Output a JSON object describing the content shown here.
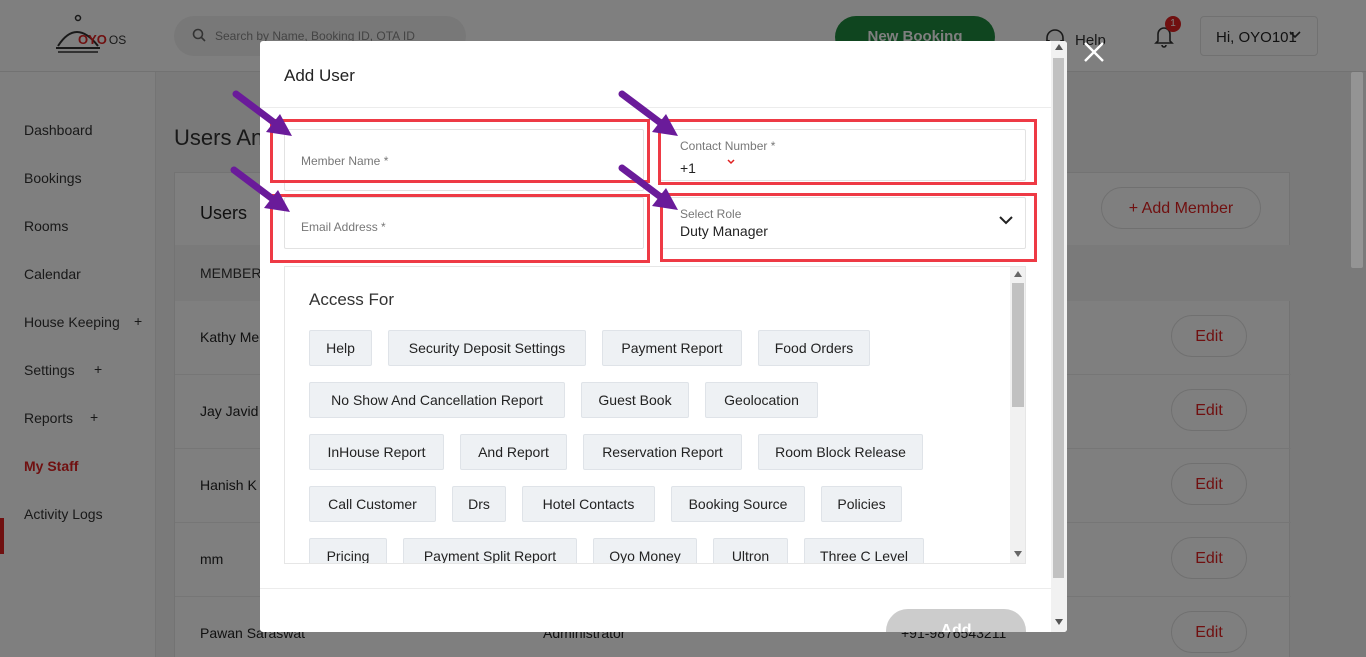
{
  "app": {
    "logo_text": "OYO",
    "logo_suffix": "OS",
    "search_placeholder": "Search by Name, Booking ID, OTA ID",
    "new_booking_label": "New Booking",
    "help_label": "Help",
    "notification_count": "1",
    "user_greeting": "Hi, OYO101"
  },
  "sidebar": {
    "items": [
      {
        "label": "Dashboard"
      },
      {
        "label": "Bookings"
      },
      {
        "label": "Rooms"
      },
      {
        "label": "Calendar"
      },
      {
        "label": "House Keeping",
        "expand": "+"
      },
      {
        "label": "Settings",
        "expand": "+"
      },
      {
        "label": "Reports",
        "expand": "+"
      },
      {
        "label": "My Staff"
      },
      {
        "label": "Activity Logs"
      }
    ]
  },
  "main": {
    "title": "Users And Access",
    "card_title": "Users",
    "add_member_label": "+  Add Member",
    "column_member": "MEMBER",
    "rows": [
      {
        "name": "Kathy Me",
        "role": "",
        "phone": "",
        "edit": "Edit"
      },
      {
        "name": "Jay Javid",
        "role": "",
        "phone": "",
        "edit": "Edit"
      },
      {
        "name": "Hanish K",
        "role": "",
        "phone": "",
        "edit": "Edit"
      },
      {
        "name": "mm",
        "role": "",
        "phone": "",
        "edit": "Edit"
      },
      {
        "name": "Pawan Saraswat",
        "role": "Administrator",
        "phone": "+91-9876543211",
        "edit": "Edit"
      }
    ]
  },
  "modal": {
    "title": "Add User",
    "member_name_placeholder": "Member Name *",
    "contact_label": "Contact Number *",
    "country_code": "+1",
    "email_placeholder": "Email Address *",
    "role_label": "Select Role",
    "role_value": "Duty Manager",
    "access_title": "Access For",
    "access_chips": [
      "Help",
      "Security Deposit Settings",
      "Payment Report",
      "Food Orders",
      "No Show And Cancellation Report",
      "Guest Book",
      "Geolocation",
      "InHouse Report",
      "And Report",
      "Reservation Report",
      "Room Block Release",
      "Call Customer",
      "Drs",
      "Hotel Contacts",
      "Booking Source",
      "Policies",
      "Pricing",
      "Payment Split Report",
      "Oyo Money",
      "Ultron",
      "Three C Level"
    ],
    "add_label": "Add"
  },
  "colors": {
    "brand_red": "#e02020",
    "highlight": "#ee3a45",
    "arrow": "#6a1b9a",
    "new_booking_green": "#1e8a3e"
  }
}
